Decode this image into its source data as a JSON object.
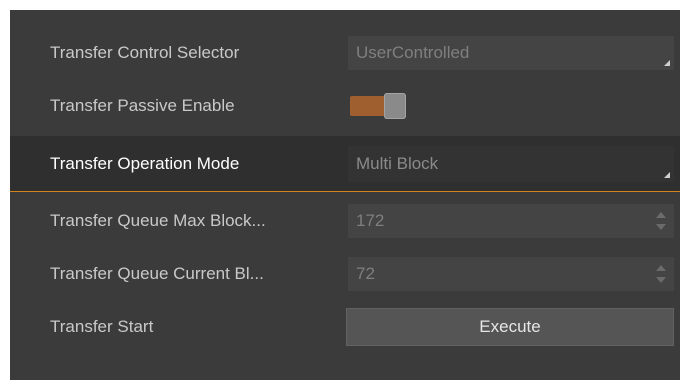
{
  "rows": [
    {
      "label": "Transfer Control Selector",
      "value": "UserControlled"
    },
    {
      "label": "Transfer Passive Enable",
      "toggle_on": true
    },
    {
      "label": "Transfer Operation Mode",
      "value": "Multi Block"
    },
    {
      "label": "Transfer Queue Max Block...",
      "value": "172"
    },
    {
      "label": "Transfer Queue Current Bl...",
      "value": "72"
    },
    {
      "label": "Transfer Start",
      "button_label": "Execute"
    }
  ],
  "colors": {
    "panel_bg": "#3b3b3b",
    "selected_row_bg": "#2f2f2f",
    "accent": "#d4831f",
    "toggle_track": "#a05f2e"
  }
}
